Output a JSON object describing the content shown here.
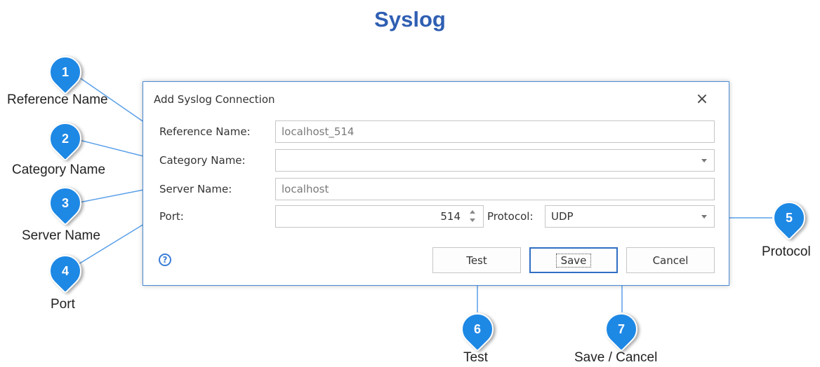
{
  "page": {
    "title": "Syslog"
  },
  "dialog": {
    "title": "Add Syslog Connection",
    "close_icon": "×",
    "fields": {
      "reference_name": {
        "label": "Reference Name:",
        "value": "localhost_514"
      },
      "category_name": {
        "label": "Category Name:",
        "value": ""
      },
      "server_name": {
        "label": "Server Name:",
        "value": "localhost"
      },
      "port": {
        "label": "Port:",
        "value": "514"
      },
      "protocol": {
        "label": "Protocol:",
        "value": "UDP"
      }
    },
    "help_icon": "?",
    "buttons": {
      "test": "Test",
      "save": "Save",
      "cancel": "Cancel"
    }
  },
  "callouts": [
    {
      "number": "1",
      "label": "Reference Name"
    },
    {
      "number": "2",
      "label": "Category Name"
    },
    {
      "number": "3",
      "label": "Server Name"
    },
    {
      "number": "4",
      "label": "Port"
    },
    {
      "number": "5",
      "label": "Protocol"
    },
    {
      "number": "6",
      "label": "Test"
    },
    {
      "number": "7",
      "label": "Save / Cancel"
    }
  ],
  "colors": {
    "title": "#2f5fb3",
    "badge": "#1e88e5",
    "leader_line": "#5aa0e8",
    "dialog_border": "#4a8ad6"
  }
}
